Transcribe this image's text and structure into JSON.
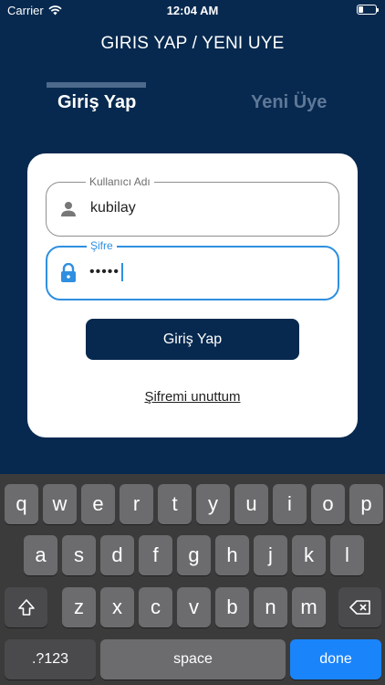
{
  "status_bar": {
    "carrier": "Carrier",
    "time": "12:04 AM",
    "battery_level": 0.25
  },
  "header": {
    "title": "GIRIS YAP / YENI UYE"
  },
  "tabs": {
    "login": "Giriş Yap",
    "register": "Yeni Üye"
  },
  "form": {
    "username": {
      "label": "Kullanıcı Adı",
      "value": "kubilay",
      "icon": "person-icon"
    },
    "password": {
      "label": "Şifre",
      "value": "•••••",
      "icon": "lock-icon"
    },
    "submit_label": "Giriş Yap",
    "forgot_label": "Şifremi unuttum"
  },
  "keyboard": {
    "row1": [
      "q",
      "w",
      "e",
      "r",
      "t",
      "y",
      "u",
      "i",
      "o",
      "p"
    ],
    "row2": [
      "a",
      "s",
      "d",
      "f",
      "g",
      "h",
      "j",
      "k",
      "l"
    ],
    "row3": [
      "z",
      "x",
      "c",
      "v",
      "b",
      "n",
      "m"
    ],
    "numbers_label": ".?123",
    "space_label": "space",
    "done_label": "done",
    "shift_icon": "shift-icon",
    "backspace_icon": "backspace-icon"
  },
  "colors": {
    "background": "#07294f",
    "accent": "#2f8fe0",
    "done_key": "#1a84fb"
  }
}
